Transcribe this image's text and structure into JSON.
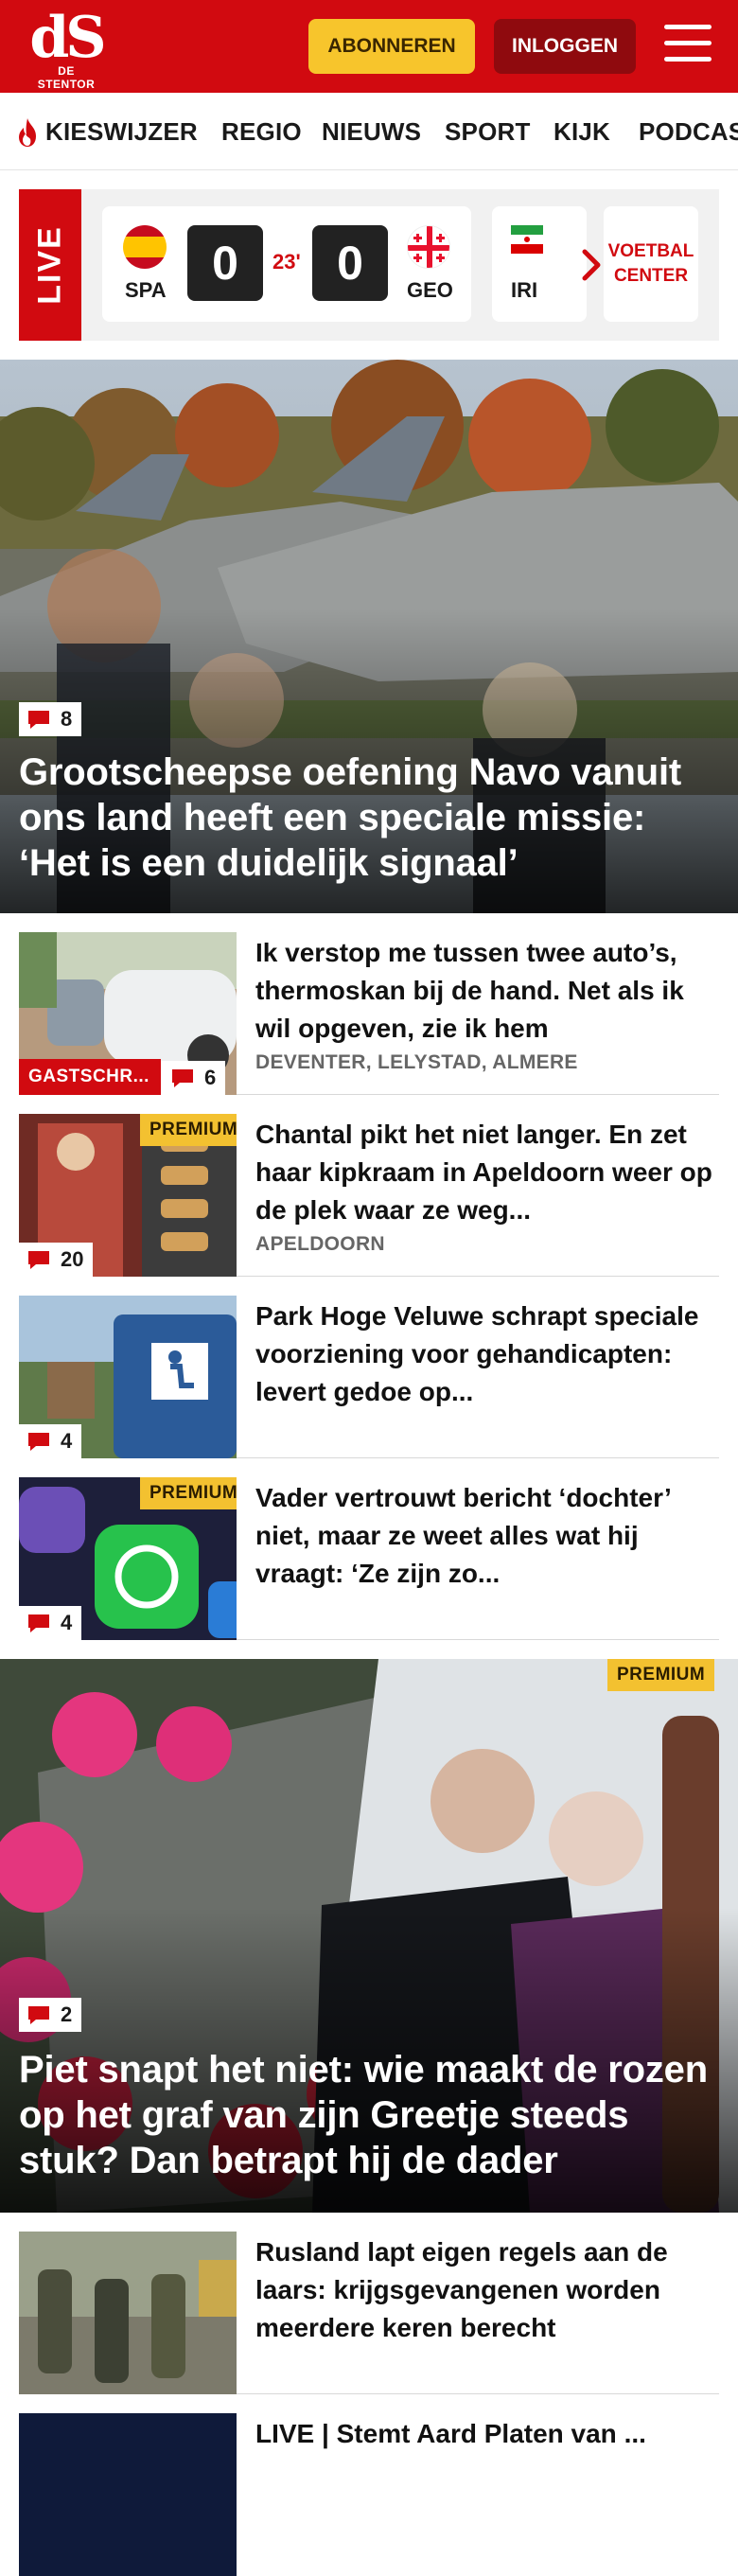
{
  "header": {
    "logo_mark": "dS",
    "logo_name": "DE STENTOR",
    "subscribe_label": "ABONNEREN",
    "login_label": "INLOGGEN",
    "menu_icon": "hamburger-icon",
    "brand_color": "#d10a10"
  },
  "nav": {
    "items": [
      "KIESWIJZER",
      "REGIO",
      "NIEUWS",
      "SPORT",
      "KIJK",
      "PODCAS"
    ]
  },
  "live": {
    "label": "LIVE",
    "match": {
      "home": "SPA",
      "away": "GEO",
      "home_score": "0",
      "away_score": "0",
      "minute": "23'"
    },
    "next_team": "IRI",
    "center_label_1": "VOETBAL",
    "center_label_2": "CENTER"
  },
  "hero1": {
    "comments": "8",
    "title": "Grootscheepse oefening Navo vanuit ons land heeft een speciale missie: ‘Het is een duidelijk signaal’"
  },
  "articles": [
    {
      "title": "Ik verstop me tussen twee auto’s, thermoskan bij de hand. Net als ik wil opgeven, zie ik hem",
      "meta": "DEVENTER, LELYSTAD, ALMERE",
      "label": "GASTSCHR...",
      "comments": "6"
    },
    {
      "title": "Chantal pikt het niet langer. En zet haar kipkraam in Apeldoorn weer op de plek waar ze weg...",
      "meta": "APELDOORN",
      "premium": "PREMIUM",
      "comments": "20"
    },
    {
      "title": "Park Hoge Veluwe schrapt speciale voorziening voor gehandicapten: levert gedoe op...",
      "comments": "4"
    },
    {
      "title": "Vader vertrouwt bericht ‘dochter’ niet, maar ze weet alles wat hij vraagt: ‘Ze zijn zo...",
      "premium": "PREMIUM",
      "comments": "4"
    }
  ],
  "hero2": {
    "premium": "PREMIUM",
    "comments": "2",
    "title": "Piet snapt het niet: wie maakt de rozen op het graf van zijn Greetje steeds stuk? Dan betrapt hij de dader"
  },
  "articles2": [
    {
      "title": "Rusland lapt eigen regels aan de laars: krijgsgevangenen worden meerdere keren berecht"
    },
    {
      "title": "LIVE | Stemt Aard Platen van ..."
    }
  ]
}
